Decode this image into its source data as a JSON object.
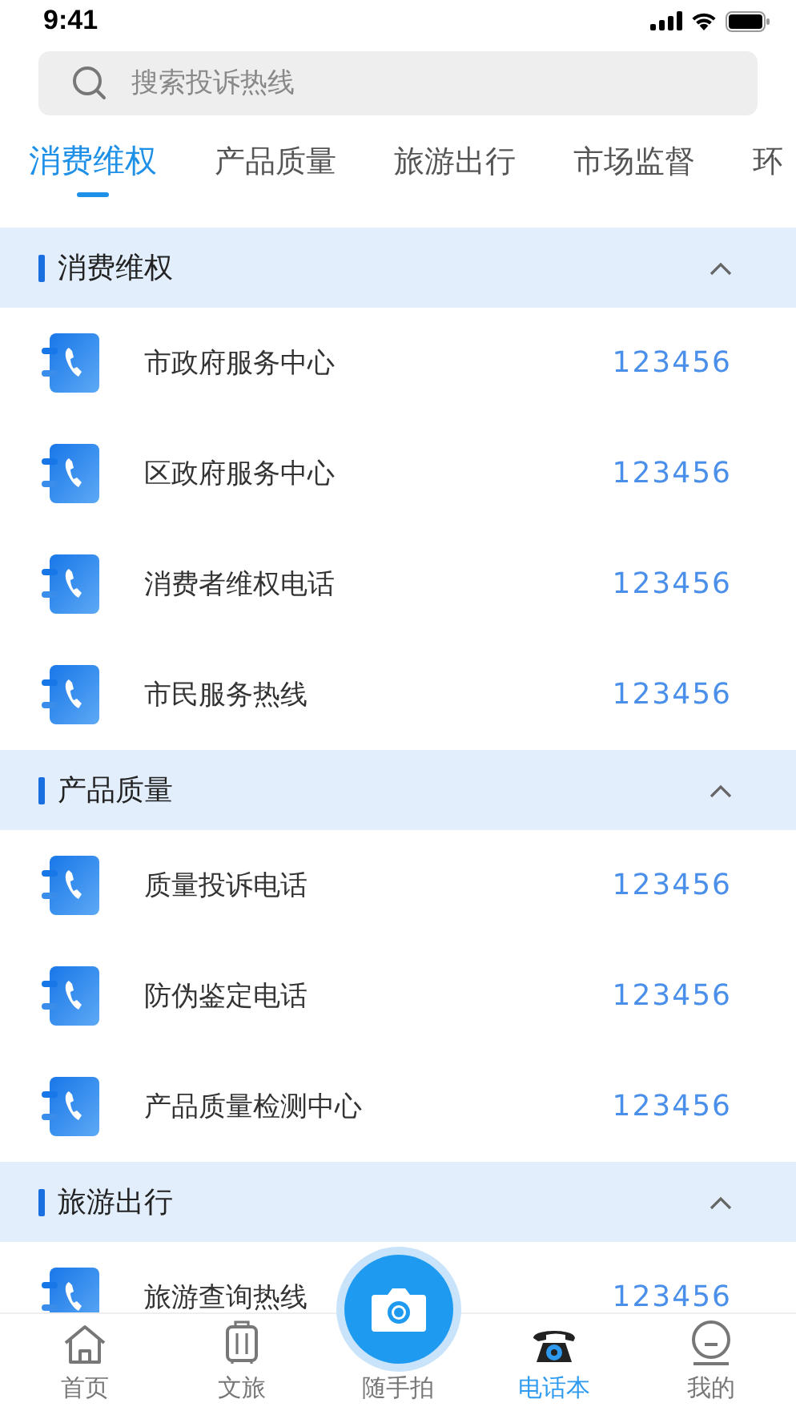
{
  "status_bar": {
    "time": "9:41"
  },
  "search": {
    "placeholder": "搜索投诉热线"
  },
  "tabs": [
    {
      "label": "消费维权",
      "selected": true
    },
    {
      "label": "产品质量",
      "selected": false
    },
    {
      "label": "旅游出行",
      "selected": false
    },
    {
      "label": "市场监督",
      "selected": false
    },
    {
      "label": "环",
      "selected": false
    }
  ],
  "sections": [
    {
      "title": "消费维权",
      "expanded": true,
      "items": [
        {
          "name": "市政府服务中心",
          "phone": "123456"
        },
        {
          "name": "区政府服务中心",
          "phone": "123456"
        },
        {
          "name": "消费者维权电话",
          "phone": "123456"
        },
        {
          "name": "市民服务热线",
          "phone": "123456"
        }
      ]
    },
    {
      "title": "产品质量",
      "expanded": true,
      "items": [
        {
          "name": "质量投诉电话",
          "phone": "123456"
        },
        {
          "name": "防伪鉴定电话",
          "phone": "123456"
        },
        {
          "name": "产品质量检测中心",
          "phone": "123456"
        }
      ]
    },
    {
      "title": "旅游出行",
      "expanded": true,
      "items": [
        {
          "name": "旅游查询热线",
          "phone": "123456"
        }
      ]
    }
  ],
  "bottom_nav": [
    {
      "label": "首页",
      "selected": false,
      "kind": "tab"
    },
    {
      "label": "文旅",
      "selected": false,
      "kind": "tab"
    },
    {
      "label": "随手拍",
      "selected": false,
      "kind": "raised"
    },
    {
      "label": "电话本",
      "selected": true,
      "kind": "tab"
    },
    {
      "label": "我的",
      "selected": false,
      "kind": "tab"
    }
  ]
}
